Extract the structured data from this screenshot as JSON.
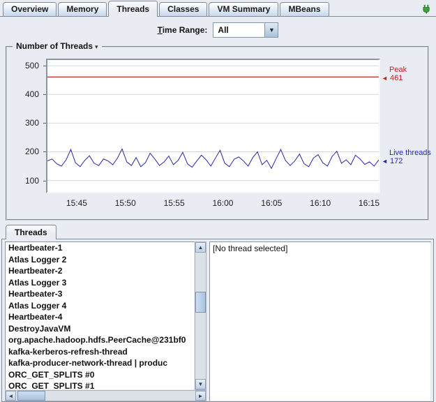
{
  "tabs": [
    {
      "label": "Overview",
      "selected": false
    },
    {
      "label": "Memory",
      "selected": false
    },
    {
      "label": "Threads",
      "selected": true
    },
    {
      "label": "Classes",
      "selected": false
    },
    {
      "label": "VM Summary",
      "selected": false
    },
    {
      "label": "MBeans",
      "selected": false
    }
  ],
  "toolbar": {
    "time_range_label": "Time Range:",
    "time_range_value": "All"
  },
  "icons": {
    "dropdown": "▾",
    "combo_arrow": "▼",
    "up": "▲",
    "down": "▼",
    "left": "◄",
    "right": "►",
    "annotation_pointer": "◄",
    "connection_status": "connected-plug"
  },
  "chart_data": {
    "type": "line",
    "title": "Number of Threads",
    "x_ticks": [
      "15:45",
      "15:50",
      "15:55",
      "16:00",
      "16:05",
      "16:10",
      "16:15"
    ],
    "x_start": "15:42",
    "x_end": "16:16",
    "y_ticks": [
      100,
      200,
      300,
      400,
      500
    ],
    "ylim": [
      60,
      520
    ],
    "grid": true,
    "legend_position": "right",
    "series": [
      {
        "name": "Peak",
        "type": "constant",
        "color": "#c22222",
        "value": 461
      },
      {
        "name": "Live threads",
        "type": "samples",
        "color": "#2626a8",
        "values": [
          168,
          175,
          158,
          150,
          172,
          208,
          162,
          148,
          170,
          186,
          160,
          152,
          175,
          168,
          155,
          178,
          210,
          165,
          152,
          180,
          148,
          162,
          195,
          175,
          152,
          165,
          185,
          155,
          170,
          198,
          158,
          146,
          168,
          188,
          172,
          150,
          178,
          205,
          160,
          148,
          174,
          182,
          168,
          150,
          180,
          200,
          155,
          170,
          142,
          176,
          208,
          170,
          152,
          168,
          192,
          158,
          148,
          178,
          190,
          162,
          150,
          184,
          202,
          160,
          172,
          155,
          188,
          175,
          156,
          165,
          150,
          172
        ]
      }
    ],
    "annotations": [
      {
        "label": "Peak",
        "value": 461,
        "color": "#c22222"
      },
      {
        "label": "Live threads",
        "value": 172,
        "color": "#2626a8"
      }
    ]
  },
  "threads_panel": {
    "tab_label": "Threads",
    "detail_placeholder": "[No thread selected]",
    "threads": [
      "Heartbeater-1",
      "Atlas Logger 2",
      "Heartbeater-2",
      "Atlas Logger 3",
      "Heartbeater-3",
      "Atlas Logger 4",
      "Heartbeater-4",
      "DestroyJavaVM",
      "org.apache.hadoop.hdfs.PeerCache@231bf0",
      "kafka-kerberos-refresh-thread",
      "kafka-producer-network-thread | produc",
      "ORC_GET_SPLITS #0",
      "ORC_GET_SPLITS #1"
    ]
  }
}
